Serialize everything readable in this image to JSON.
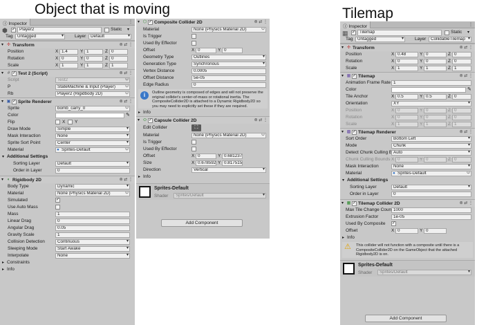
{
  "captions": {
    "left": "Object that is moving",
    "right": "Tilemap"
  },
  "left": {
    "tab": "Inspector",
    "object": {
      "name": "Player2",
      "static_label": "Static",
      "tag_label": "Tag",
      "tag": "Untagged",
      "layer_label": "Layer",
      "layer": "Default"
    },
    "transform": {
      "title": "Transform",
      "rows": [
        {
          "label": "Position",
          "x": "1.4",
          "y": "1",
          "z": "0"
        },
        {
          "label": "Rotation",
          "x": "0",
          "y": "0",
          "z": "0"
        },
        {
          "label": "Scale",
          "x": "1",
          "y": "1",
          "z": "1"
        }
      ]
    },
    "script": {
      "title": "Test 2 (Script)",
      "rows": [
        {
          "label": "Script",
          "value": "Test2"
        },
        {
          "label": "P",
          "value": "StateMachine & Input (Player)"
        },
        {
          "label": "Rb",
          "value": "Player2 (Rigidbody 2D)"
        }
      ]
    },
    "sprite_renderer": {
      "title": "Sprite Renderer",
      "rows": [
        {
          "label": "Sprite",
          "value": "bomb_carry_0"
        },
        {
          "label": "Color",
          "value": ""
        },
        {
          "label": "Flip",
          "x": "X",
          "y": "Y"
        },
        {
          "label": "Draw Mode",
          "value": "Simple"
        },
        {
          "label": "Mask Interaction",
          "value": "None"
        },
        {
          "label": "Sprite Sort Point",
          "value": "Center"
        },
        {
          "label": "Material",
          "value": "Sprites-Default"
        }
      ],
      "additional": "Additional Settings",
      "sorting_layer_label": "Sorting Layer",
      "sorting_layer": "Default",
      "order_label": "Order in Layer",
      "order": "0"
    },
    "rigidbody": {
      "title": "Rigidbody 2D",
      "rows": [
        {
          "label": "Body Type",
          "value": "Dynamic"
        },
        {
          "label": "Material",
          "value": "None (Physics Material 2D)"
        },
        {
          "label": "Simulated",
          "value": "✓"
        },
        {
          "label": "Use Auto Mass",
          "value": ""
        },
        {
          "label": "Mass",
          "value": "1"
        },
        {
          "label": "Linear Drag",
          "value": "0"
        },
        {
          "label": "Angular Drag",
          "value": "0.05"
        },
        {
          "label": "Gravity Scale",
          "value": "1"
        },
        {
          "label": "Collision Detection",
          "value": "Continuous"
        },
        {
          "label": "Sleeping Mode",
          "value": "Start Awake"
        },
        {
          "label": "Interpolate",
          "value": "None"
        }
      ],
      "constraints": "Constraints",
      "info": "Info"
    }
  },
  "middle": {
    "composite": {
      "title": "Composite Collider 2D",
      "rows": [
        {
          "label": "Material",
          "value": "None (Physics Material 2D)"
        },
        {
          "label": "Is Trigger",
          "value": ""
        },
        {
          "label": "Used By Effector",
          "value": ""
        },
        {
          "label": "Offset",
          "x": "0",
          "y": "0"
        },
        {
          "label": "Geometry Type",
          "value": "Outlines"
        },
        {
          "label": "Generation Type",
          "value": "Synchronous"
        },
        {
          "label": "Vertex Distance",
          "value": "0.0005"
        },
        {
          "label": "Offset Distance",
          "value": "5e-05"
        },
        {
          "label": "Edge Radius",
          "value": "0"
        }
      ],
      "info_text": "Outline geometry is composed of edges and will not preserve the original collider's center-of-mass or rotational inertia. The CompositeCollider2D is attached to a Dynamic Rigidbody2D so you may need to explicitly set these if they are required.",
      "info": "Info"
    },
    "capsule": {
      "title": "Capsule Collider 2D",
      "edit_label": "Edit Collider",
      "rows": [
        {
          "label": "Material",
          "value": "None (Physics Material 2D)"
        },
        {
          "label": "Is Trigger",
          "value": ""
        },
        {
          "label": "Used By Effector",
          "value": ""
        },
        {
          "label": "Offset",
          "x": "0",
          "y": "0.681237"
        },
        {
          "label": "Size",
          "x": "0.678592",
          "y": "0.817515"
        },
        {
          "label": "Direction",
          "value": "Vertical"
        }
      ],
      "info": "Info"
    },
    "material": {
      "name": "Sprites-Default",
      "shader_label": "Shader",
      "shader": "Sprites/Default"
    },
    "add_component": "Add Component"
  },
  "right": {
    "tab": "Inspector",
    "object": {
      "name": "Tilemap",
      "static_label": "Static",
      "tag_label": "Tag",
      "tag": "Untagged",
      "layer_label": "Layer",
      "layer": "CollidableTilemap"
    },
    "transform": {
      "title": "Transform",
      "rows": [
        {
          "label": "Position",
          "x": "0.48",
          "y": "0",
          "z": "0"
        },
        {
          "label": "Rotation",
          "x": "0",
          "y": "0",
          "z": "0"
        },
        {
          "label": "Scale",
          "x": "1",
          "y": "1",
          "z": "1"
        }
      ]
    },
    "tilemap": {
      "title": "Tilemap",
      "rows": [
        {
          "label": "Animation Frame Rate",
          "value": "1"
        },
        {
          "label": "Color",
          "value": ""
        },
        {
          "label": "Tile Anchor",
          "x": "0.5",
          "y": "0.5",
          "z": "0"
        },
        {
          "label": "Orientation",
          "value": "XY"
        },
        {
          "label": "Position",
          "x": "0",
          "y": "0",
          "z": "0"
        },
        {
          "label": "Rotation",
          "x": "0",
          "y": "0",
          "z": "0"
        },
        {
          "label": "Scale",
          "x": "1",
          "y": "1",
          "z": "1"
        }
      ]
    },
    "tilemap_renderer": {
      "title": "Tilemap Renderer",
      "rows": [
        {
          "label": "Sort Order",
          "value": "Bottom Left"
        },
        {
          "label": "Mode",
          "value": "Chunk"
        },
        {
          "label": "Detect Chunk Culling Bo",
          "value": "Auto"
        },
        {
          "label": "Chunk Culling Bounds",
          "x": "0",
          "y": "0",
          "z": "0"
        },
        {
          "label": "Mask Interaction",
          "value": "None"
        },
        {
          "label": "Material",
          "value": "Sprites-Default"
        }
      ],
      "additional": "Additional Settings",
      "sorting_layer_label": "Sorting Layer",
      "sorting_layer": "Default",
      "order_label": "Order in Layer",
      "order": "0"
    },
    "tilemap_collider": {
      "title": "Tilemap Collider 2D",
      "rows": [
        {
          "label": "Max Tile Change Count",
          "value": "1000"
        },
        {
          "label": "Extrusion Factor",
          "value": "1e-05"
        },
        {
          "label": "Used By Composite",
          "value": "✓"
        },
        {
          "label": "Offset",
          "x": "0",
          "y": "0"
        }
      ],
      "info": "Info",
      "info_text": "This collider will not function with a composite until there is a CompositeCollider2D on the GameObject that the attached Rigidbody2D is on."
    },
    "material": {
      "name": "Sprites-Default",
      "shader_label": "Shader",
      "shader": "Sprites/Default"
    },
    "add_component": "Add Component"
  }
}
